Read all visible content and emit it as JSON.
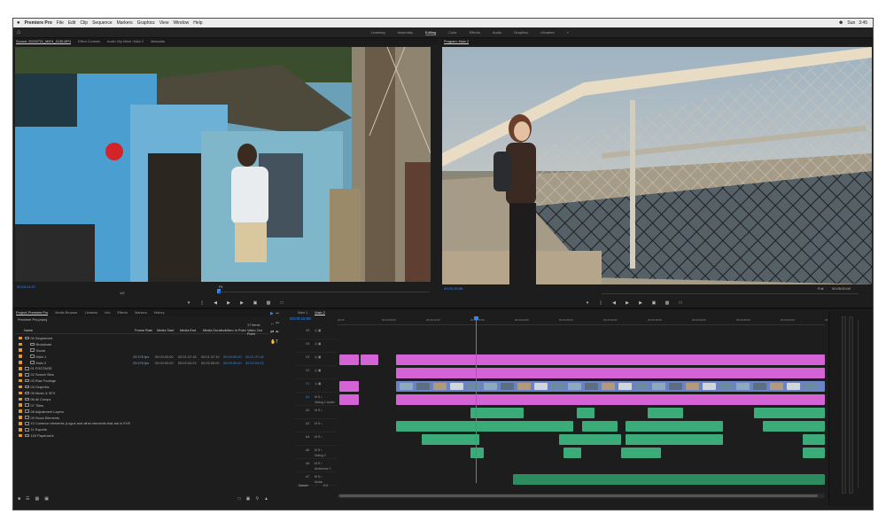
{
  "menu_bar": {
    "apple": "",
    "app_name": "Premiere Pro",
    "items": [
      "File",
      "Edit",
      "Clip",
      "Sequence",
      "Markers",
      "Graphics",
      "View",
      "Window",
      "Help"
    ],
    "right": [
      "Sun",
      "3:45"
    ]
  },
  "workspaces": [
    "Learning",
    "Assembly",
    "Editing",
    "Color",
    "Effects",
    "Audio",
    "Graphics",
    "Libraries"
  ],
  "active_workspace": "Editing",
  "source_monitor": {
    "tabs": [
      "Source: 20220721_M001_0135.MP4",
      "Effect Controls",
      "Audio Clip Mixer: Main 2",
      "Metadata"
    ],
    "timecode_left": "00:04:14:07",
    "timecode_right": "",
    "fit": "1/2",
    "zoom": "Fit"
  },
  "program_monitor": {
    "tabs": [
      "Program: Main 2"
    ],
    "timecode_left": "00:00:15:08",
    "timecode_right": "00:05:00:00",
    "fit": "Fit",
    "zoom": "Full"
  },
  "project_panel": {
    "tabs": [
      "Project: Premiere Pro",
      "Media Browser",
      "Libraries",
      "Info",
      "Effects",
      "Markers",
      "History"
    ],
    "path": "Premiere Pro.prproj",
    "count": "17 Items",
    "columns": [
      "Name",
      "Frame Rate",
      "Media Start",
      "Media End",
      "Media Duration",
      "Video In Point",
      "Video Out Point"
    ],
    "rows": [
      {
        "name": "00 Sequences",
        "fr": "",
        "ms": "",
        "me": "",
        "md": "",
        "vi": "",
        "vo": "",
        "indent": 0
      },
      {
        "name": "Broadcast",
        "fr": "",
        "ms": "",
        "me": "",
        "md": "",
        "vi": "",
        "vo": "",
        "indent": 1
      },
      {
        "name": "Social",
        "fr": "",
        "ms": "",
        "me": "",
        "md": "",
        "vi": "",
        "vo": "",
        "indent": 1
      },
      {
        "name": "Main 1",
        "fr": "23.976 fps",
        "ms": "00:00:00:00",
        "me": "00:01:37:18",
        "md": "00:01:37:19",
        "vi": "00:00:00:00",
        "vo": "00:01:37:18",
        "indent": 1
      },
      {
        "name": "Main 2",
        "fr": "23.976 fps",
        "ms": "00:00:00:00",
        "me": "00:02:04:23",
        "md": "00:02:05:00",
        "vi": "00:00:00:00",
        "vo": "00:02:04:23",
        "indent": 1
      },
      {
        "name": "01 FOOTAGE",
        "fr": "",
        "ms": "",
        "me": "",
        "md": "",
        "vi": "",
        "vo": "",
        "indent": 0
      },
      {
        "name": "02 Search Bins",
        "fr": "",
        "ms": "",
        "me": "",
        "md": "",
        "vi": "",
        "vo": "",
        "indent": 0
      },
      {
        "name": "03 Raw Footage",
        "fr": "",
        "ms": "",
        "me": "",
        "md": "",
        "vi": "",
        "vo": "",
        "indent": 0
      },
      {
        "name": "04 Graphics",
        "fr": "",
        "ms": "",
        "me": "",
        "md": "",
        "vi": "",
        "vo": "",
        "indent": 0
      },
      {
        "name": "05 Music & SFX",
        "fr": "",
        "ms": "",
        "me": "",
        "md": "",
        "vi": "",
        "vo": "",
        "indent": 0
      },
      {
        "name": "06 All Comps",
        "fr": "",
        "ms": "",
        "me": "",
        "md": "",
        "vi": "",
        "vo": "",
        "indent": 0
      },
      {
        "name": "07 Titles",
        "fr": "",
        "ms": "",
        "me": "",
        "md": "",
        "vi": "",
        "vo": "",
        "indent": 0
      },
      {
        "name": "08 Adjustment Layers",
        "fr": "",
        "ms": "",
        "me": "",
        "md": "",
        "vi": "",
        "vo": "",
        "indent": 0
      },
      {
        "name": "09 Stock Elements",
        "fr": "",
        "ms": "",
        "me": "",
        "md": "",
        "vi": "",
        "vo": "",
        "indent": 0
      },
      {
        "name": "10 Common elements (Logos and other elements that are in EVE",
        "fr": "",
        "ms": "",
        "me": "",
        "md": "",
        "vi": "",
        "vo": "",
        "indent": 0
      },
      {
        "name": "11 Exports",
        "fr": "",
        "ms": "",
        "me": "",
        "md": "",
        "vi": "",
        "vo": "",
        "indent": 0
      },
      {
        "name": "100 Paperwork",
        "fr": "",
        "ms": "",
        "me": "",
        "md": "",
        "vi": "",
        "vo": "",
        "indent": 0
      }
    ]
  },
  "timeline": {
    "tabs": [
      "Main 1",
      "Main 2"
    ],
    "active_tab": "Main 2",
    "timecode": "00:00:15:08",
    "ruler": [
      "00:00",
      "00:00:05:00",
      "00:00:10:00",
      "00:00:15:00",
      "00:00:20:00",
      "00:00:25:00",
      "00:00:30:00",
      "00:00:35:00",
      "00:00:40:00",
      "00:00:45:00",
      "00:00:50:00",
      "00:00:55:00"
    ],
    "tracks": [
      "V5",
      "V4",
      "V3",
      "V2",
      "V1",
      "A1",
      "A2",
      "A3",
      "A4",
      "A5",
      "A6",
      "A7"
    ],
    "track_names": {
      "A1": "Dialog 1 Audio",
      "A5": "Dialog 2",
      "A6": "Ambience 1",
      "A7": "Music"
    },
    "master": "Master",
    "master_value": "0.0"
  },
  "colors": {
    "accent": "#2d8ceb",
    "video_clip": "#d463d5",
    "video_thumb": "#6a82c6",
    "audio_clip": "#3bab7a",
    "adjustment_clip": "#45a44a",
    "folder_label": "#e39a28"
  }
}
